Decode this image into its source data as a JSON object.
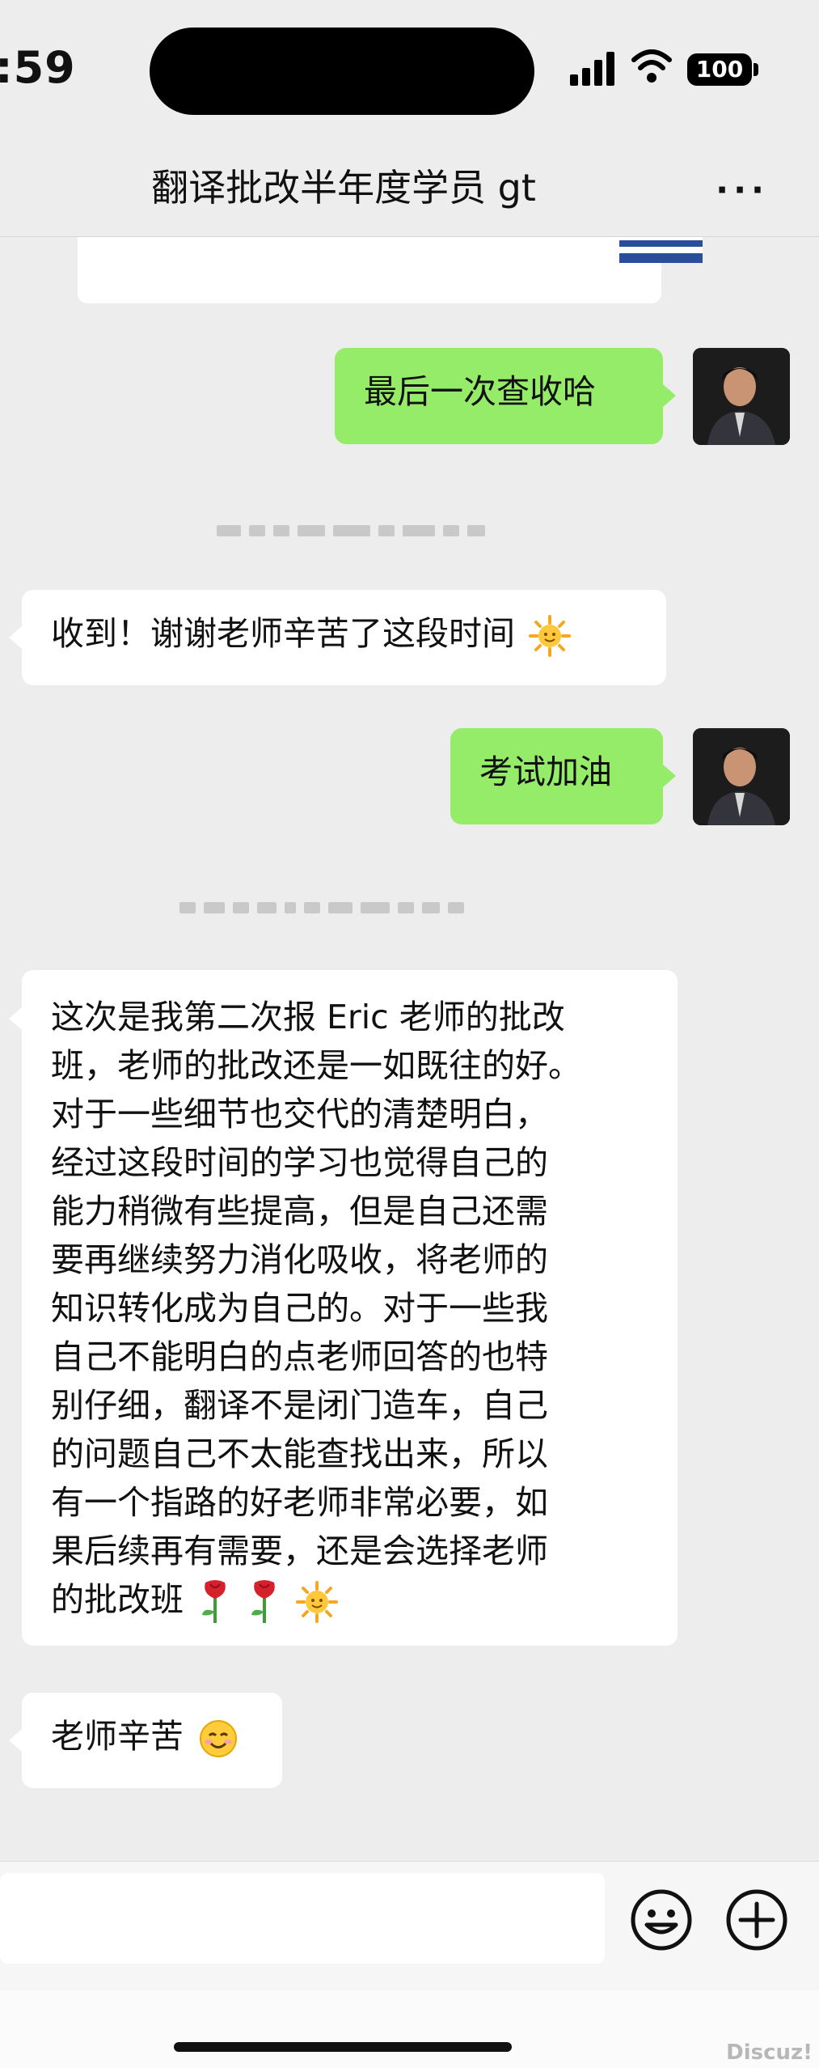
{
  "status_bar": {
    "time": ":59",
    "battery": "100"
  },
  "nav": {
    "title": "翻译批改半年度学员 gt",
    "more": "···"
  },
  "messages": [
    {
      "text": "最后一次查收哈"
    },
    {
      "text": "收到！谢谢老师辛苦了这段时间"
    },
    {
      "text": "考试加油"
    },
    {
      "lines": [
        "这次是我第二次报 Eric 老师的批改",
        "班，老师的批改还是一如既往的好。",
        "对于一些细节也交代的清楚明白，",
        "经过这段时间的学习也觉得自己的",
        "能力稍微有些提高，但是自己还需",
        "要再继续努力消化吸收，将老师的",
        "知识转化成为自己的。对于一些我",
        "自己不能明白的点老师回答的也特",
        "别仔细，翻译不是闭门造车，自己",
        "的问题自己不太能查找出来，所以",
        "有一个指路的好老师非常必要，如",
        "果后续再有需要，还是会选择老师",
        "的批改班"
      ]
    },
    {
      "text": "老师辛苦"
    }
  ],
  "icons": {
    "sun": "sun-emoji",
    "rose": "rose-emoji",
    "smile": "smiling-face-emoji"
  },
  "watermark": "Discuz!"
}
